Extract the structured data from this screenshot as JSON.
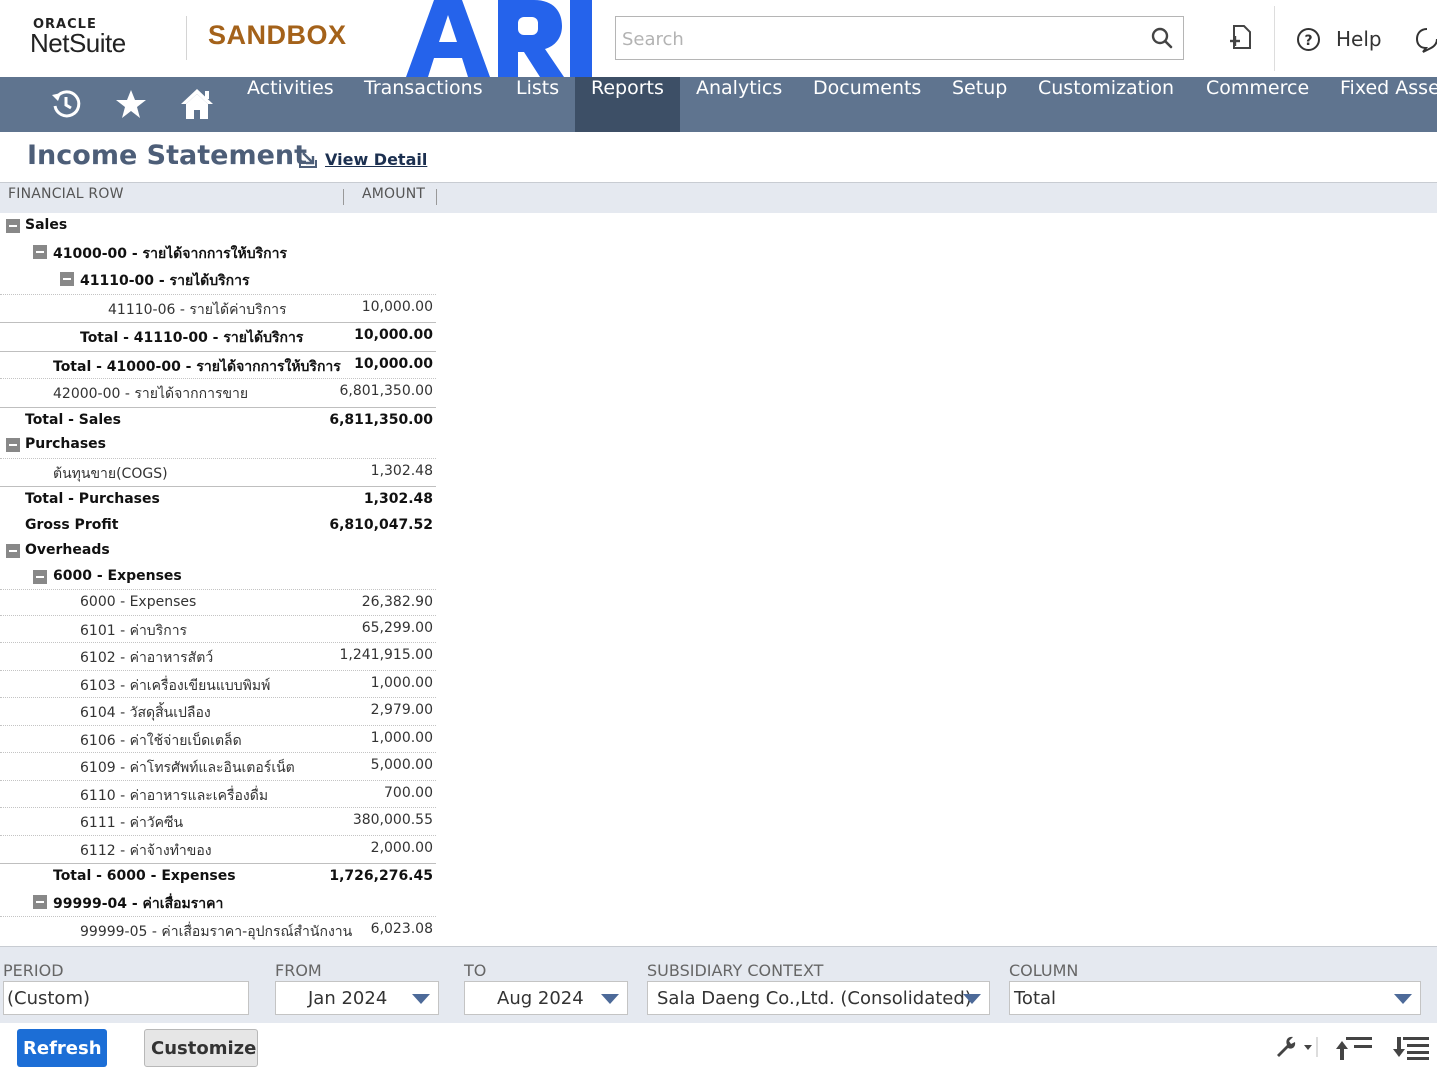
{
  "header": {
    "brand_oracle": "ORACLE",
    "brand_netsuite": "NetSuite",
    "environment": "SANDBOX",
    "company_logo": "ARI",
    "search_placeholder": "Search",
    "help_label": "Help",
    "icons": [
      "search-icon",
      "create-record-icon",
      "help-icon",
      "chat-icon"
    ]
  },
  "nav": {
    "icons": [
      "recent-records-icon",
      "favorites-star-icon",
      "home-icon"
    ],
    "items": [
      "Activities",
      "Transactions",
      "Lists",
      "Reports",
      "Analytics",
      "Documents",
      "Setup",
      "Customization",
      "Commerce",
      "Fixed Assets"
    ],
    "active": "Reports"
  },
  "page": {
    "title": "Income Statement",
    "view_detail": "View Detail"
  },
  "grid": {
    "col_financial_row": "FINANCIAL ROW",
    "col_amount": "AMOUNT",
    "rows": [
      {
        "label": "Sales",
        "amount": "",
        "level": 0,
        "bold": true,
        "collapsible": true
      },
      {
        "label": "41000-00 - รายได้จากการให้บริการ",
        "amount": "",
        "level": 1,
        "bold": true,
        "collapsible": true
      },
      {
        "label": "41110-00 - รายได้บริการ",
        "amount": "",
        "level": 2,
        "bold": true,
        "collapsible": true
      },
      {
        "label": "41110-06 - รายได้ค่าบริการ",
        "amount": "10,000.00",
        "level": 3,
        "bold": false
      },
      {
        "label": "Total - 41110-00 - รายได้บริการ",
        "amount": "10,000.00",
        "level": 2,
        "bold": true,
        "total": true
      },
      {
        "label": "Total - 41000-00 - รายได้จากการให้บริการ",
        "amount": "10,000.00",
        "level": 1,
        "bold": true,
        "total": true
      },
      {
        "label": "42000-00 - รายได้จากการขาย",
        "amount": "6,801,350.00",
        "level": 1,
        "bold": false
      },
      {
        "label": "Total - Sales",
        "amount": "6,811,350.00",
        "level": 0,
        "bold": true,
        "total": true
      },
      {
        "label": "Purchases",
        "amount": "",
        "level": 0,
        "bold": true,
        "collapsible": true
      },
      {
        "label": "ต้นทุนขาย(COGS)",
        "amount": "1,302.48",
        "level": 1,
        "bold": false
      },
      {
        "label": "Total - Purchases",
        "amount": "1,302.48",
        "level": 0,
        "bold": true,
        "total": true
      },
      {
        "label": "Gross Profit",
        "amount": "6,810,047.52",
        "level": 0,
        "bold": true
      },
      {
        "label": "Overheads",
        "amount": "",
        "level": 0,
        "bold": true,
        "collapsible": true
      },
      {
        "label": "6000 - Expenses",
        "amount": "",
        "level": 1,
        "bold": true,
        "collapsible": true
      },
      {
        "label": "6000 - Expenses",
        "amount": "26,382.90",
        "level": 2,
        "bold": false
      },
      {
        "label": "6101 - ค่าบริการ",
        "amount": "65,299.00",
        "level": 2,
        "bold": false
      },
      {
        "label": "6102 - ค่าอาหารสัตว์",
        "amount": "1,241,915.00",
        "level": 2,
        "bold": false
      },
      {
        "label": "6103 - ค่าเครื่องเขียนแบบพิมพ์",
        "amount": "1,000.00",
        "level": 2,
        "bold": false
      },
      {
        "label": "6104 - วัสดุสิ้นเปลือง",
        "amount": "2,979.00",
        "level": 2,
        "bold": false
      },
      {
        "label": "6106 - ค่าใช้จ่ายเบ็ดเตล็ด",
        "amount": "1,000.00",
        "level": 2,
        "bold": false
      },
      {
        "label": "6109 - ค่าโทรศัพท์และอินเตอร์เน็ต",
        "amount": "5,000.00",
        "level": 2,
        "bold": false
      },
      {
        "label": "6110 - ค่าอาหารและเครื่องดื่ม",
        "amount": "700.00",
        "level": 2,
        "bold": false
      },
      {
        "label": "6111 - ค่าวัคซีน",
        "amount": "380,000.55",
        "level": 2,
        "bold": false
      },
      {
        "label": "6112 - ค่าจ้างทำของ",
        "amount": "2,000.00",
        "level": 2,
        "bold": false
      },
      {
        "label": "Total - 6000 - Expenses",
        "amount": "1,726,276.45",
        "level": 1,
        "bold": true,
        "total": true
      },
      {
        "label": "99999-04 - ค่าเสื่อมราคา",
        "amount": "",
        "level": 1,
        "bold": true,
        "collapsible": true
      },
      {
        "label": "99999-05 - ค่าเสื่อมราคา-อุปกรณ์สำนักงาน",
        "amount": "6,023.08",
        "level": 2,
        "bold": false
      }
    ]
  },
  "filters": {
    "period_label": "PERIOD",
    "period_value": "(Custom)",
    "from_label": "FROM",
    "from_value": "Jan 2024",
    "to_label": "TO",
    "to_value": "Aug 2024",
    "subsidiary_label": "SUBSIDIARY CONTEXT",
    "subsidiary_value": "Sala Daeng Co.,Ltd. (Consolidated)",
    "column_label": "COLUMN",
    "column_value": "Total"
  },
  "buttons": {
    "refresh": "Refresh",
    "customize": "Customize"
  },
  "colors": {
    "nav_bg": "#5f748f",
    "nav_active": "#3d4f66",
    "sandbox": "#a4621a",
    "ari_blue": "#2563eb",
    "refresh_btn": "#1c6ed6",
    "title": "#4d5e78"
  }
}
